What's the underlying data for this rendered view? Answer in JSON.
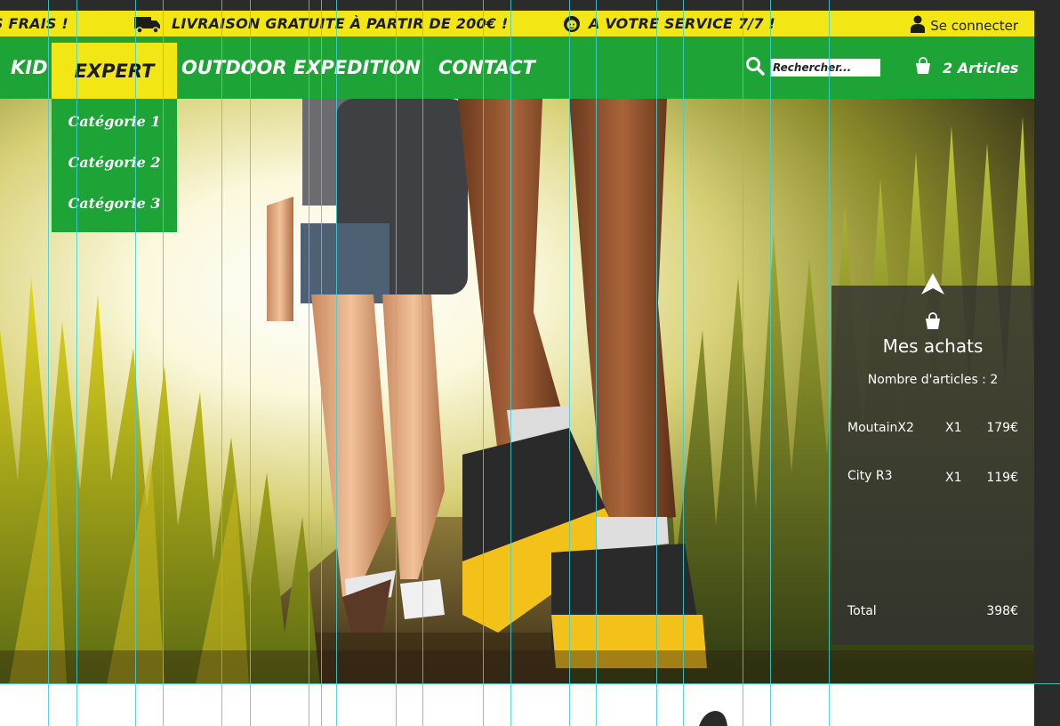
{
  "topbar": {
    "left_text": "S FRAIS !",
    "delivery_text": "LIVRAISON GRATUITE À PARTIR DE 200€ !",
    "service_text": "A VOTRE SERVICE 7/7 !",
    "login_label": "Se connecter",
    "background": "#f2e614",
    "icons": [
      "truck-icon",
      "support-agent-icon",
      "user-icon"
    ]
  },
  "nav": {
    "items": [
      {
        "label": "KID"
      },
      {
        "label": "EXPERT",
        "active": true
      },
      {
        "label": "OUTDOOR EXPEDITION"
      },
      {
        "label": "CONTACT"
      }
    ],
    "background": "#1ea336",
    "active_background": "#f2e614"
  },
  "dropdown": {
    "items": [
      {
        "label": "Catégorie 1"
      },
      {
        "label": "Catégorie 2"
      },
      {
        "label": "Catégorie 3"
      }
    ]
  },
  "search": {
    "placeholder": "Rechercher..."
  },
  "cart": {
    "label": "2 Articles"
  },
  "cart_panel": {
    "title": "Mes achats",
    "count_text": "Nombre d'articles : 2",
    "items": [
      {
        "name": "MoutainX2",
        "qty": "X1",
        "price": "179€"
      },
      {
        "name": "City R3",
        "qty": "X1",
        "price": "119€"
      }
    ],
    "total_label": "Total",
    "total_value": "398€"
  }
}
